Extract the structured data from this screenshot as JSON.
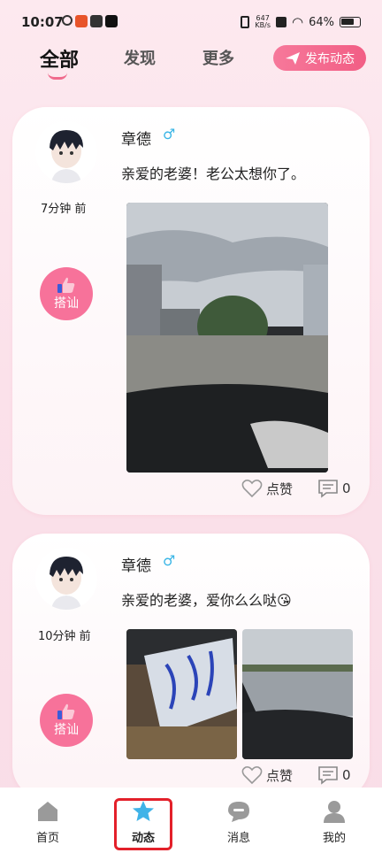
{
  "status_bar": {
    "time": "10:07",
    "net_speed_value": "647",
    "net_speed_unit": "KB/s",
    "battery": "64%"
  },
  "tabs": [
    {
      "label": "全部"
    },
    {
      "label": "发现"
    },
    {
      "label": "更多"
    }
  ],
  "publish_button": {
    "label": "发布动态"
  },
  "posts": [
    {
      "username": "章德",
      "gender_symbol": "♂",
      "content": "亲爱的老婆！老公太想你了。",
      "time": "7分钟 前",
      "greet_label": "搭讪",
      "like_label": "点赞",
      "comment_count": "0"
    },
    {
      "username": "章德",
      "gender_symbol": "♂",
      "content": "亲爱的老婆，爱你么么哒😘",
      "time": "10分钟 前",
      "greet_label": "搭讪",
      "like_label": "点赞",
      "comment_count": "0"
    }
  ],
  "bottom_nav": [
    {
      "label": "首页",
      "icon": "home-icon"
    },
    {
      "label": "动态",
      "icon": "star-icon",
      "active": true
    },
    {
      "label": "消息",
      "icon": "message-icon"
    },
    {
      "label": "我的",
      "icon": "profile-icon"
    }
  ],
  "colors": {
    "accent": "#f25e85",
    "gender": "#39b5e6",
    "highlight_box": "#e3202a"
  }
}
